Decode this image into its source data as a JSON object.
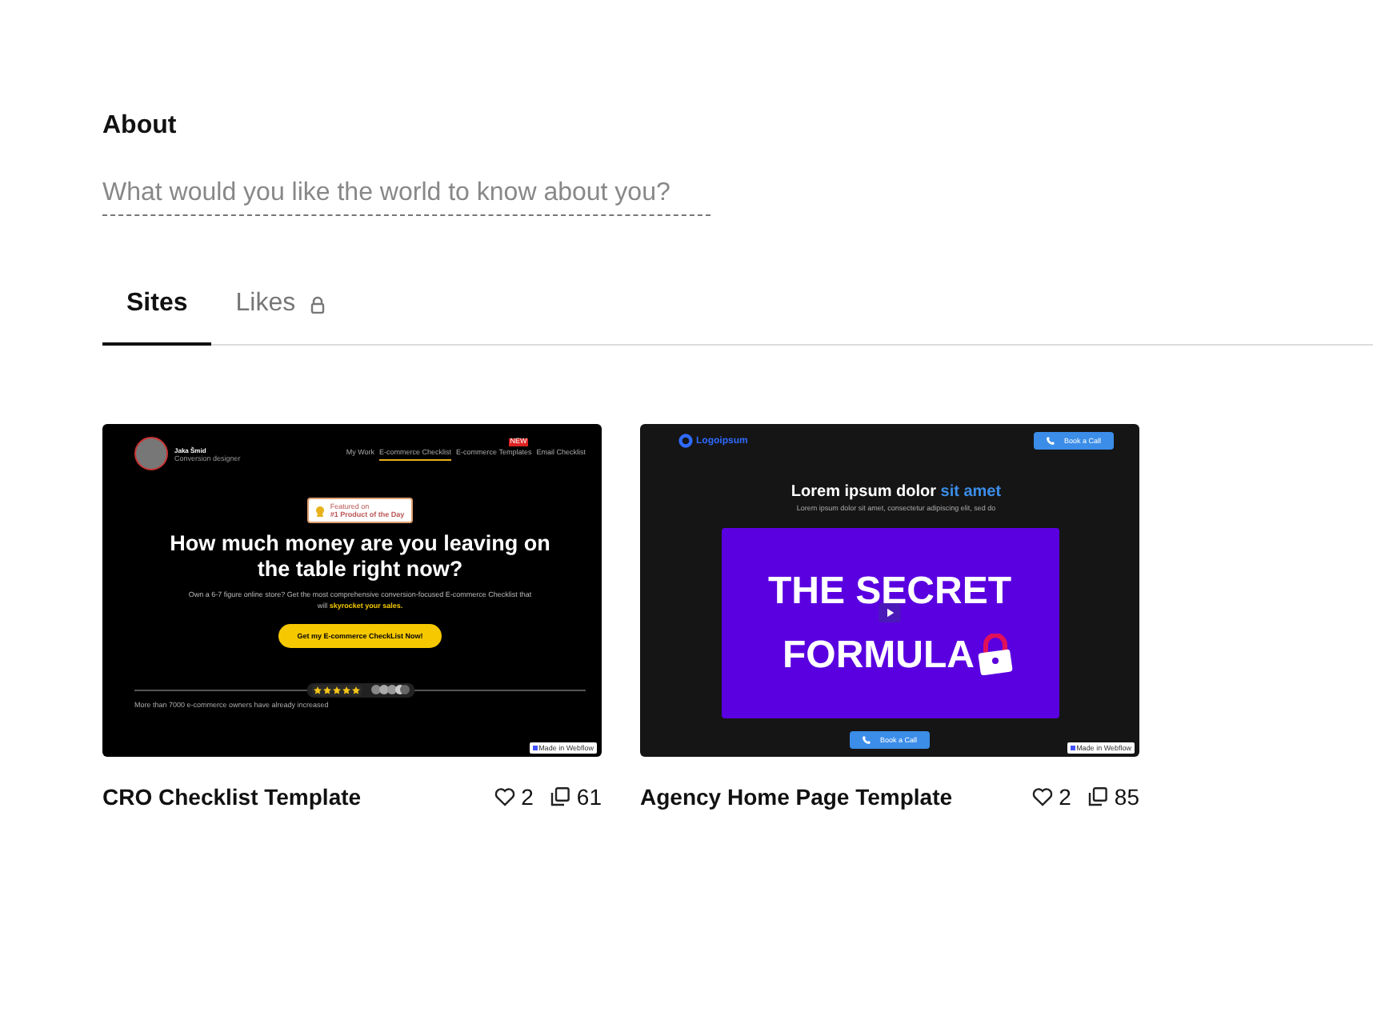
{
  "about": {
    "heading": "About",
    "placeholder": "What would you like the world to know about you?"
  },
  "tabs": [
    {
      "label": "Sites",
      "selected": true,
      "locked": false
    },
    {
      "label": "Likes",
      "selected": false,
      "locked": true
    }
  ],
  "sites": [
    {
      "kind": "checklist",
      "title": "CRO Checklist Template",
      "likes": "2",
      "clones": "61",
      "preview": {
        "name": "Jaka Šmid",
        "role": "Conversion designer",
        "nav": [
          {
            "label": "My Work",
            "selected": false
          },
          {
            "label": "E-commerce Checklist",
            "selected": true
          },
          {
            "label": "E-commerce Templates",
            "selected": false,
            "badge": "NEW"
          },
          {
            "label": "Email Checklist",
            "selected": false
          }
        ],
        "award_kicker": "Featured on",
        "award": "#1 Product of the Day",
        "headline": "How much money are you leaving on the table right now?",
        "lead": "Own a 6-7 figure online store? Get the most comprehensive conversion-focused E-commerce Checklist that will",
        "lead_highlight": "skyrocket your sales.",
        "cta": "Get my E-commerce CheckList Now!",
        "stars": 5,
        "footer": "More than 7000 e-commerce owners have already increased",
        "made_in": "Made in Webflow"
      }
    },
    {
      "kind": "agency",
      "title": "Agency Home Page Template",
      "likes": "2",
      "clones": "85",
      "preview": {
        "logo": "Logoipsum",
        "call": "Book a Call",
        "headline": "Lorem ipsum dolor",
        "headline_accent": "sit amet",
        "lead": "Lorem ipsum dolor sit amet, consectetur adipiscing elit, sed do",
        "video_line_1": "THE SECRET",
        "video_line_2": "FORMULA",
        "cta": "Book a Call",
        "made_in": "Made in Webflow"
      }
    }
  ]
}
